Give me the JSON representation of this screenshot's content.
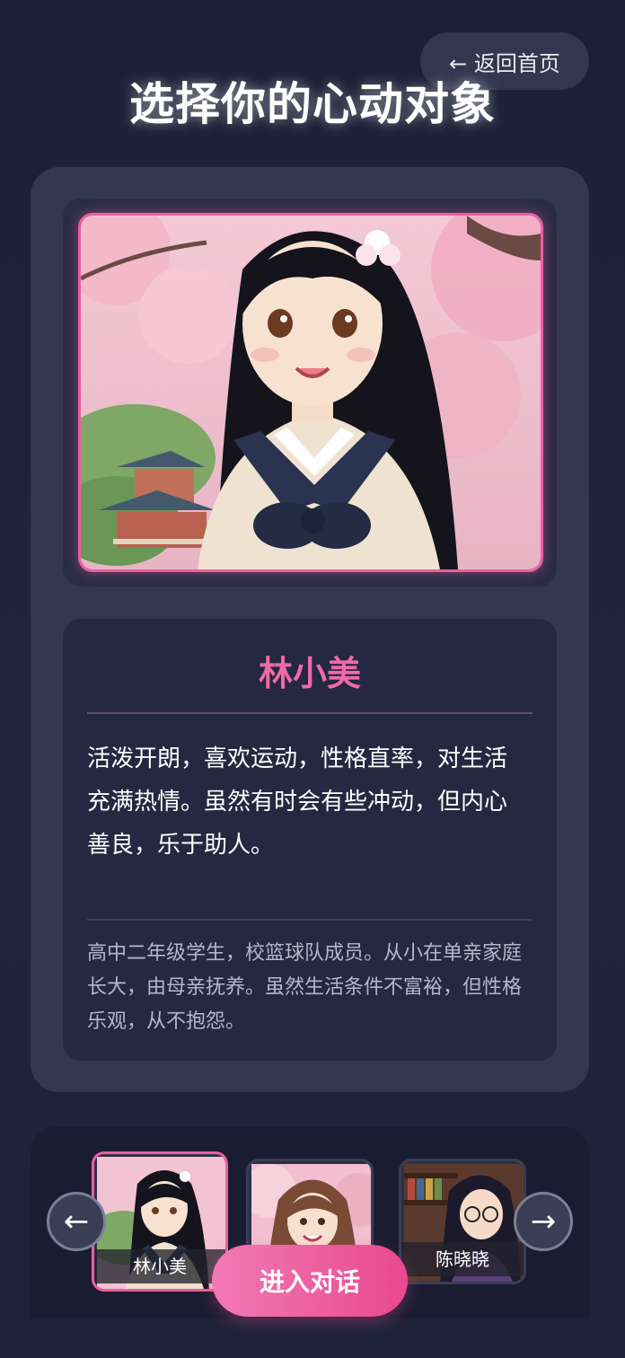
{
  "header": {
    "back_label": "← 返回首页",
    "title": "选择你的心动对象"
  },
  "profile": {
    "name": "林小美",
    "personality": "活泼开朗，喜欢运动，性格直率，对生活充满热情。虽然有时会有些冲动，但内心善良，乐于助人。",
    "background": "高中二年级学生，校篮球队成员。从小在单亲家庭长大，由母亲抚养。虽然生活条件不富裕，但性格乐观，从不抱怨。"
  },
  "carousel": {
    "prev_icon": "←",
    "next_icon": "→",
    "characters": [
      {
        "name": "林小美",
        "selected": true
      },
      {
        "name": "",
        "selected": false
      },
      {
        "name": "陈晓晓",
        "selected": false
      }
    ]
  },
  "actions": {
    "enter_label": "进入对话"
  },
  "colors": {
    "accent": "#ea5fa2",
    "name": "#ef6aa8",
    "card": "#33374f",
    "background": "#1c1f35"
  }
}
